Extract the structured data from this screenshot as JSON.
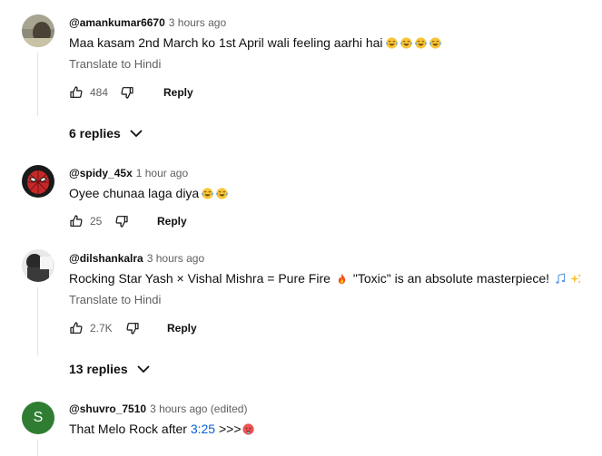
{
  "comments": [
    {
      "author": "@amankumar6670",
      "time": "3 hours ago",
      "text": "Maa kasam 2nd  March ko 1st April wali feeling aarhi hai",
      "emojis": [
        "face-with-tears-of-joy",
        "face-with-tears-of-joy",
        "face-with-tears-of-joy",
        "face-with-tears-of-joy"
      ],
      "translate": "Translate to Hindi",
      "likes": "484",
      "reply_label": "Reply",
      "replies_label": "6 replies"
    },
    {
      "author": "@spidy_45x",
      "time": "1 hour ago",
      "text": "Oyee chunaa laga diya",
      "emojis": [
        "face-with-tears-of-joy",
        "face-with-tears-of-joy"
      ],
      "likes": "25",
      "reply_label": "Reply"
    },
    {
      "author": "@dilshankalra",
      "time": "3 hours ago",
      "text_a": "Rocking Star Yash × Vishal Mishra = Pure Fire",
      "text_b": "\"Toxic\" is an absolute masterpiece!",
      "emojis": [
        "fire",
        "musical-notes",
        "sparkles"
      ],
      "translate": "Translate to Hindi",
      "likes": "2.7K",
      "reply_label": "Reply",
      "replies_label": "13 replies"
    },
    {
      "author": "@shuvro_7510",
      "time": "3 hours ago (edited)",
      "avatar_letter": "S",
      "avatar_color": "#2e7d32",
      "text_a": "That Melo Rock after",
      "timestamp_link": "3:25",
      "text_b": ">>>",
      "emojis": [
        "hot-face"
      ]
    }
  ],
  "colors": {
    "link": "#065fd4",
    "secondary_text": "#606060",
    "primary_text": "#0f0f0f"
  }
}
